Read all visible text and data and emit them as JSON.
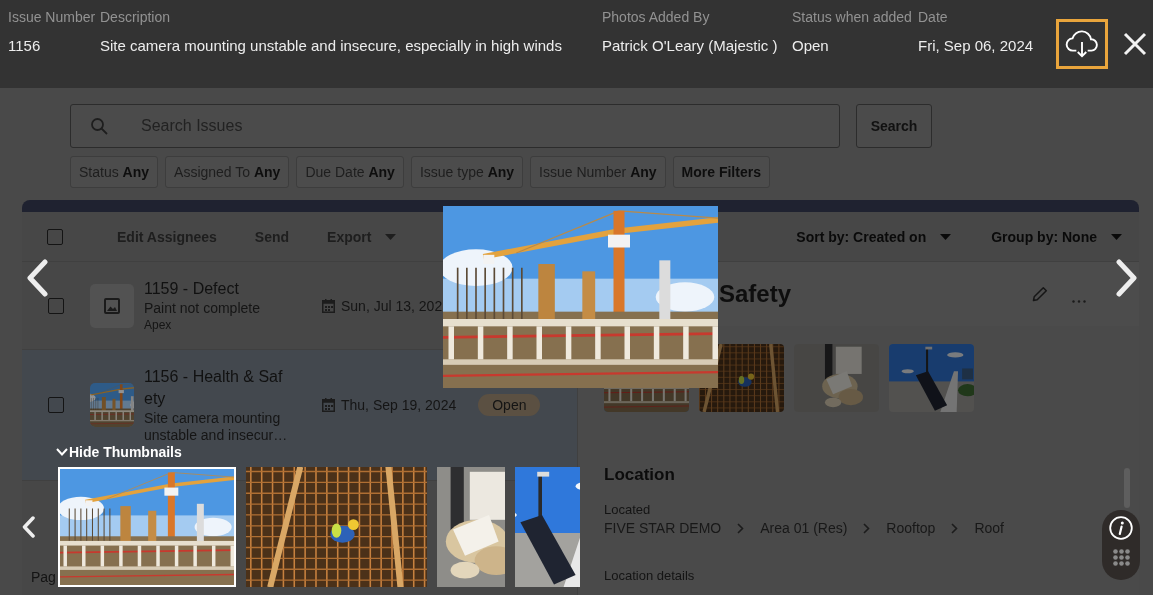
{
  "viewer": {
    "columns": [
      {
        "header": "Issue Number",
        "value": "1156"
      },
      {
        "header": "Description",
        "value": "Site camera mounting unstable and insecure, especially in high winds"
      },
      {
        "header": "Photos Added By",
        "value": "Patrick O'Leary (Majestic )"
      },
      {
        "header": "Status when added",
        "value": "Open"
      },
      {
        "header": "Date",
        "value": "Fri, Sep 06, 2024"
      }
    ],
    "photo": {
      "kind": "crane"
    },
    "thumbnails_toggle": {
      "label": "Hide Thumbnails",
      "expanded": true
    },
    "thumbnails": [
      {
        "kind": "crane",
        "selected": true
      },
      {
        "kind": "rebar",
        "selected": false
      },
      {
        "kind": "debris",
        "selected": false
      },
      {
        "kind": "solar",
        "selected": false
      }
    ]
  },
  "page": {
    "search": {
      "placeholder": "Search Issues",
      "button": "Search"
    },
    "filters": [
      {
        "label": "Status",
        "value": "Any"
      },
      {
        "label": "Assigned To",
        "value": "Any"
      },
      {
        "label": "Due Date",
        "value": "Any"
      },
      {
        "label": "Issue type",
        "value": "Any"
      },
      {
        "label": "Issue Number",
        "value": "Any"
      },
      {
        "label": "More Filters"
      }
    ],
    "toolbar": {
      "select_all": {
        "checked": false
      },
      "actions": [
        {
          "kind": "action",
          "label": "Edit Assignees",
          "disabled": true
        },
        {
          "kind": "action",
          "label": "Send",
          "disabled": true
        },
        {
          "kind": "dropdown",
          "label": "Export",
          "disabled": true
        }
      ],
      "views": [
        {
          "kind": "dropdown",
          "label": "Sort by: Created on"
        },
        {
          "kind": "dropdown",
          "label": "Group by: None"
        }
      ]
    },
    "issues": [
      {
        "title": "1159 - Defect",
        "description": "Paint not complete",
        "assignee": "Apex",
        "date": "Sun, Jul 13, 202",
        "thumbnail": {
          "kind": "placeholder"
        },
        "checked": false,
        "selected": false
      },
      {
        "title": "1156 - Health & Safety",
        "description": "Site camera mounting unstable and insecur…",
        "date": "Thu, Sep 19, 2024",
        "status": "Open",
        "thumbnail": {
          "kind": "crane"
        },
        "checked": false,
        "selected": true
      }
    ],
    "pager": "Pag",
    "detail": {
      "title": "Safety",
      "photos": [
        {
          "kind": "crane"
        },
        {
          "kind": "rebar"
        },
        {
          "kind": "debris"
        },
        {
          "kind": "solar"
        }
      ],
      "location": {
        "heading": "Location",
        "label": "Located",
        "path": [
          "FIVE STAR DEMO",
          "Area 01 (Res)",
          "Rooftop",
          "Roof"
        ]
      },
      "details_label": "Location details"
    }
  }
}
